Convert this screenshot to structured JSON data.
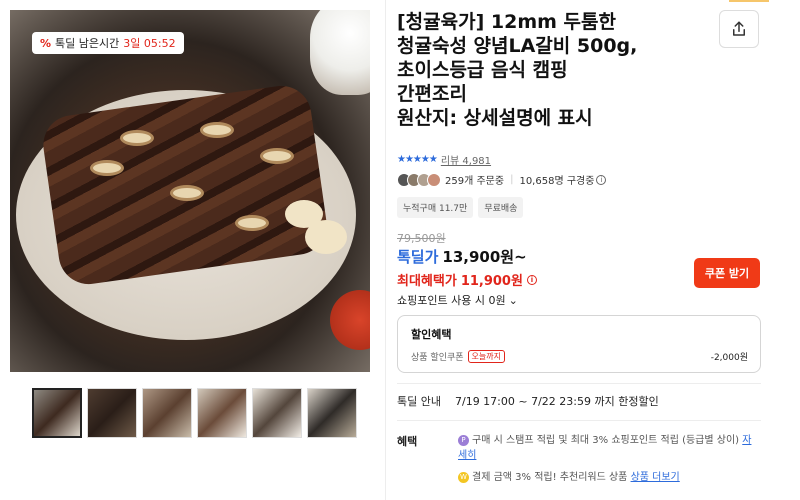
{
  "gallery": {
    "timer_icon": "%",
    "timer_label": "톡딜 남은시간",
    "timer_value": "3일 05:52",
    "thumbnail_count": 6
  },
  "product": {
    "title": "[청귤육가] 12mm 두툼한\n청귤숙성 양념LA갈비 500g,\n초이스등급 음식 캠핑\n간편조리\n원산지: 상세설명에 표시",
    "stars": "★★★★★",
    "review_label": "리뷰 4,981",
    "orders": "259개 주문중",
    "subscribers": "10,658명 구경중",
    "tags": [
      "누적구매 11.7만",
      "무료배송"
    ],
    "original_price": "79,500원",
    "deal_label": "톡딜가",
    "deal_price": "13,900원~",
    "max_label": "최대혜택가",
    "max_price": "11,900원",
    "coupon_button": "쿠폰 받기",
    "point_option": "쇼핑포인트 사용 시 0원",
    "chevron": "⌄"
  },
  "discount": {
    "title": "할인혜택",
    "item_label": "상품 할인쿠폰",
    "item_badge": "오늘까지",
    "item_amount": "-2,000원"
  },
  "notice": {
    "label": "톡딜 안내",
    "text": "7/19 17:00 ~ 7/22 23:59 까지 한정할인"
  },
  "benefits": {
    "label": "혜택",
    "item1_coin": "P",
    "item1_text": "구매 시 스탬프 적립 및 최대 3% 쇼핑포인트 적립 (등급별 상이)",
    "item1_link": "자세히",
    "item2_coin": "W",
    "item2_text": "결제 금액 3% 적립! 추천리워드 상품",
    "item2_link": "상품 더보기"
  },
  "icons": {
    "share": "share-icon",
    "timer": "discount-percent-icon",
    "info": "info-icon"
  }
}
